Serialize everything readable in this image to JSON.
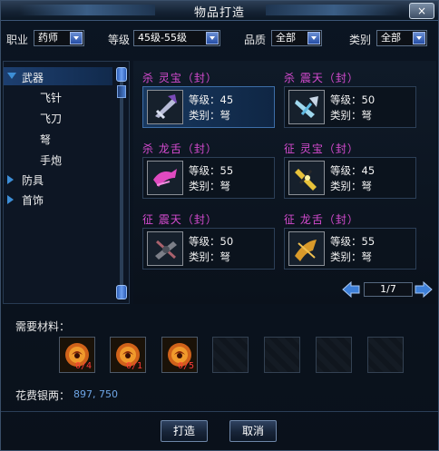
{
  "window": {
    "title": "物品打造",
    "close_label": "×"
  },
  "filters": {
    "profession": {
      "label": "职业",
      "value": "药师"
    },
    "level": {
      "label": "等级",
      "value": "45级-55级"
    },
    "quality": {
      "label": "品质",
      "value": "全部"
    },
    "category": {
      "label": "类别",
      "value": "全部"
    }
  },
  "categories": [
    {
      "label": "武器",
      "expanded": true,
      "selected": true,
      "children": [
        "飞针",
        "飞刀",
        "弩",
        "手炮"
      ]
    },
    {
      "label": "防具",
      "expanded": false
    },
    {
      "label": "首饰",
      "expanded": false
    }
  ],
  "items": [
    {
      "name": "杀 灵宝（封）",
      "level_text": "等级：45",
      "type_text": "类别：弩",
      "icon": "purple-crossbow-icon",
      "selected": true
    },
    {
      "name": "杀 震天（封）",
      "level_text": "等级：50",
      "type_text": "类别：弩",
      "icon": "blue-crossbow-icon"
    },
    {
      "name": "杀 龙舌（封）",
      "level_text": "等级：55",
      "type_text": "类别：弩",
      "icon": "pink-dragon-crossbow-icon"
    },
    {
      "name": "征 灵宝（封）",
      "level_text": "等级：45",
      "type_text": "类别：弩",
      "icon": "gold-crossbow-icon"
    },
    {
      "name": "征 震天（封）",
      "level_text": "等级：50",
      "type_text": "类别：弩",
      "icon": "dark-crossbow-icon"
    },
    {
      "name": "征 龙舌（封）",
      "level_text": "等级：55",
      "type_text": "类别：弩",
      "icon": "gold-dragon-crossbow-icon"
    }
  ],
  "pager": {
    "value": "1/7"
  },
  "materials": {
    "label": "需要材料：",
    "slots": [
      {
        "count": "0/4",
        "icon": "material-orb-icon"
      },
      {
        "count": "0/1",
        "icon": "material-orb-icon"
      },
      {
        "count": "0/5",
        "icon": "material-orb-icon"
      },
      {
        "count": "",
        "icon": ""
      },
      {
        "count": "",
        "icon": ""
      },
      {
        "count": "",
        "icon": ""
      },
      {
        "count": "",
        "icon": ""
      }
    ]
  },
  "cost": {
    "label": "花费银两：",
    "value": "897, 750"
  },
  "buttons": {
    "craft": "打造",
    "cancel": "取消"
  },
  "colors": {
    "item_name": "#d54bd0",
    "cost_value": "#6ea6e6",
    "count_red": "#ff3a3a",
    "accent_blue": "#3d8ed6"
  }
}
